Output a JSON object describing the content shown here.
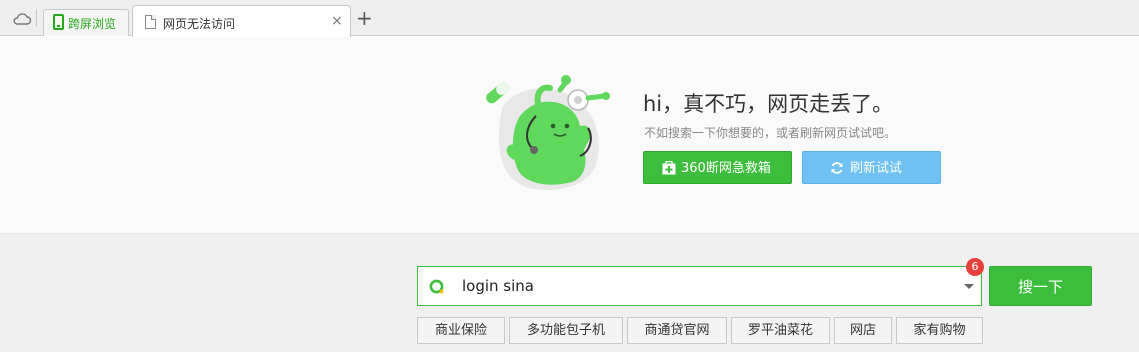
{
  "browser": {
    "tabs": [
      {
        "label": "跨屏浏览",
        "accent": "#25a91b"
      },
      {
        "label": "网页无法访问",
        "close": "×"
      }
    ],
    "new_tab": "+"
  },
  "error_page": {
    "headline": "hi，真不巧，网页走丢了。",
    "subline": "不如搜索一下你想要的，或者刷新网页试试吧。",
    "rescue_button": "360断网急救箱",
    "refresh_button": "刷新试试",
    "colors": {
      "green": "#3cbd3c",
      "blue": "#6fc2f3",
      "mascot": "#5fd85c"
    }
  },
  "search": {
    "value": "login sina",
    "badge": "6",
    "button": "搜一下",
    "suggestions": [
      "商业保险",
      "多功能包子机",
      "商通贷官网",
      "罗平油菜花",
      "网店",
      "家有购物"
    ]
  }
}
